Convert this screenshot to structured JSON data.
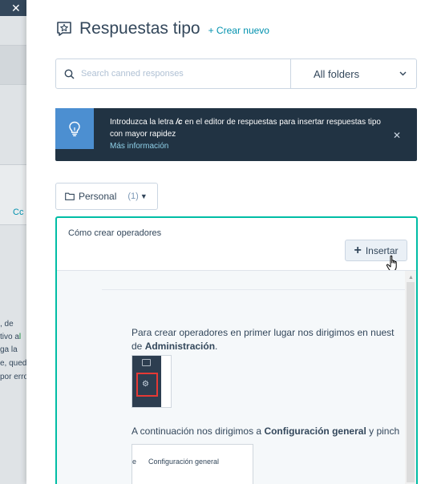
{
  "background": {
    "close_glyph": "✕",
    "cc_label": "Cc",
    "fragments": [
      ", de",
      "tivo a",
      "ga la",
      "e, queda",
      "por erro"
    ],
    "link_fragment": "l"
  },
  "header": {
    "title": "Respuestas tipo",
    "create_link": "+ Crear nuevo"
  },
  "search": {
    "placeholder": "Search canned responses",
    "folder_select": "All folders"
  },
  "banner": {
    "text_before": "Introduzca la letra ",
    "shortcut": "/c",
    "text_after": " en el editor de respuestas para insertar respuestas tipo con mayor rapidez",
    "link": "Más información"
  },
  "folder": {
    "name": "Personal",
    "count": "(1)"
  },
  "card": {
    "title": "Cómo crear operadores",
    "insert_label": "Insertar",
    "paragraph1_a": "Para crear operadores en primer lugar nos dirigimos en nuest",
    "paragraph1_b": "de ",
    "paragraph1_bold": "Administración",
    "paragraph1_end": ".",
    "paragraph2_a": "A continuación nos dirigimos a ",
    "paragraph2_bold": "Configuración general",
    "paragraph2_end": " y pinch",
    "image2_text": "Configuración general",
    "image2_mark": "e"
  },
  "colors": {
    "accent": "#00bda5",
    "banner_bg": "#213343",
    "banner_icon_bg": "#4c8fd1",
    "link": "#0091ae",
    "text": "#33475b"
  },
  "icons": [
    "close-icon",
    "canned-response-icon",
    "search-icon",
    "chevron-down-icon",
    "lightbulb-icon",
    "folder-icon",
    "plus-icon",
    "hand-cursor-icon",
    "gear-icon",
    "chart-icon"
  ]
}
